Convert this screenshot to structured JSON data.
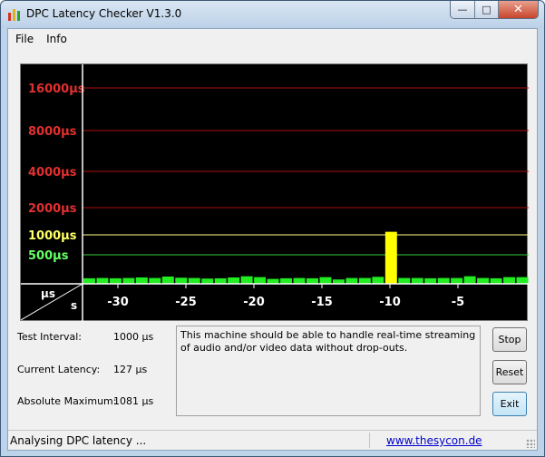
{
  "window": {
    "title": "DPC Latency Checker V1.3.0",
    "controls": {
      "minimize_icon": "minimize-icon",
      "maximize_icon": "maximize-icon",
      "close_icon": "close-icon"
    }
  },
  "menu": {
    "items": [
      "File",
      "Info"
    ]
  },
  "chart_data": {
    "type": "bar",
    "title": "",
    "y_unit_label": "µs",
    "x_unit_label": "s",
    "y_scale": "log",
    "y_ticks": [
      {
        "label": "16000µs",
        "color": "#e03030"
      },
      {
        "label": "8000µs",
        "color": "#e03030"
      },
      {
        "label": "4000µs",
        "color": "#e03030"
      },
      {
        "label": "2000µs",
        "color": "#e03030"
      },
      {
        "label": "1000µs",
        "color": "#ffff66"
      },
      {
        "label": "500µs",
        "color": "#66ff66"
      }
    ],
    "x_ticks": [
      "-30",
      "-25",
      "-20",
      "-15",
      "-10",
      "-5"
    ],
    "values": [
      95,
      100,
      95,
      100,
      110,
      100,
      125,
      105,
      100,
      90,
      95,
      110,
      130,
      115,
      85,
      95,
      100,
      95,
      115,
      75,
      100,
      100,
      120,
      1081,
      100,
      100,
      95,
      100,
      100,
      130,
      100,
      95,
      115,
      115
    ],
    "highlight_index": 23,
    "bar_color": "#22ee22",
    "highlight_color": "#ffff00"
  },
  "info": {
    "test_interval_label": "Test Interval:",
    "test_interval_value": "1000 µs",
    "current_latency_label": "Current Latency:",
    "current_latency_value": "127 µs",
    "absolute_maximum_label": "Absolute Maximum:",
    "absolute_maximum_value": "1081 µs",
    "message": "This machine should be able to handle real-time streaming of audio and/or video data without drop-outs."
  },
  "buttons": {
    "stop": "Stop",
    "reset": "Reset",
    "exit": "Exit"
  },
  "status": {
    "text": "Analysing DPC latency ...",
    "link": "www.thesycon.de"
  }
}
